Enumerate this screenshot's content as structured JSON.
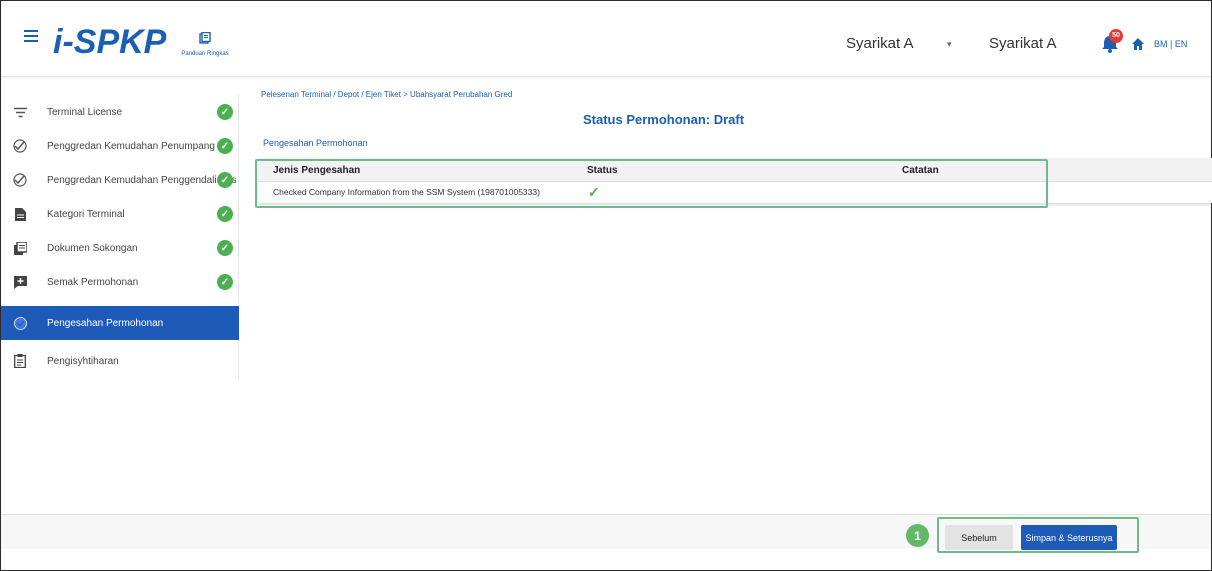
{
  "header": {
    "logo_text": "i-SPKP",
    "guide_label": "Panduan Ringkas",
    "company_left": "Syarikat A",
    "company_right": "Syarikat A",
    "notification_count": "50",
    "language": "BM | EN"
  },
  "sidebar": {
    "items": [
      {
        "label": "Terminal License",
        "icon": "filter-icon",
        "complete": true
      },
      {
        "label": "Penggredan Kemudahan Penumpang",
        "icon": "check-plus-icon",
        "complete": true
      },
      {
        "label": "Penggredan Kemudahan Penggendali Bas",
        "icon": "check-plus-icon",
        "complete": true
      },
      {
        "label": "Kategori Terminal",
        "icon": "document-icon",
        "complete": true
      },
      {
        "label": "Dokumen Sokongan",
        "icon": "documents-icon",
        "complete": true
      },
      {
        "label": "Semak Permohonan",
        "icon": "review-icon",
        "complete": true
      },
      {
        "label": "Pengesahan Permohonan",
        "icon": "verify-icon",
        "active": true
      },
      {
        "label": "Pengisyhtiharan",
        "icon": "clipboard-icon"
      }
    ]
  },
  "main": {
    "breadcrumb": "Pelesenan Terminal / Depot / Ejen Tiket > Ubahsyarat Perubahan Gred",
    "status_title": "Status Permohonan: Draft",
    "section_title": "Pengesahan Permohonan",
    "table": {
      "headers": [
        "Jenis Pengesahan",
        "Status",
        "Catatan"
      ],
      "rows": [
        {
          "jenis": "Checked Company Information from the SSM System (198701005333)",
          "status": "✓",
          "catatan": ""
        }
      ]
    }
  },
  "footer": {
    "step_number": "1",
    "prev_label": "Sebelum",
    "next_label": "Simpan & Seterusnya"
  },
  "colors": {
    "primary": "#1e5bb8",
    "success": "#4caf50",
    "highlight": "#6fb98f"
  }
}
